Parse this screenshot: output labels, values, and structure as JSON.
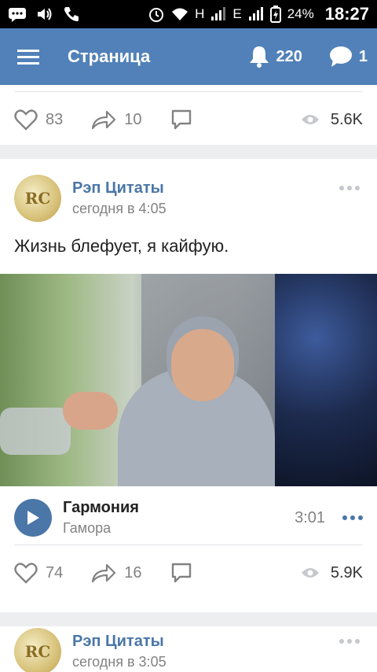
{
  "status_bar": {
    "signal_1": "H",
    "signal_2": "E",
    "battery": "24%",
    "time": "18:27"
  },
  "header": {
    "title": "Страница",
    "notifications_count": "220",
    "messages_count": "1"
  },
  "posts": [
    {
      "likes": "83",
      "shares": "10",
      "views": "5.6K"
    },
    {
      "author": "Рэп Цитаты",
      "avatar_text": "RC",
      "date": "сегодня в 4:05",
      "text": "Жизнь блефует, я кайфую.",
      "audio": {
        "title": "Гармония",
        "artist": "Гамора",
        "duration": "3:01"
      },
      "likes": "74",
      "shares": "16",
      "views": "5.9K"
    },
    {
      "author": "Рэп Цитаты",
      "avatar_text": "RC",
      "date": "сегодня в 3:05"
    }
  ],
  "icons": {
    "menu": "hamburger-icon",
    "notifications": "bell-icon",
    "messages": "chat-bubble-icon",
    "like": "heart-icon",
    "share": "share-arrow-icon",
    "comment": "comment-icon",
    "views": "eye-icon",
    "more": "more-dots-icon",
    "play": "play-icon"
  },
  "colors": {
    "header_bg": "#5181b8",
    "accent": "#4a76a8",
    "muted": "#828282"
  }
}
